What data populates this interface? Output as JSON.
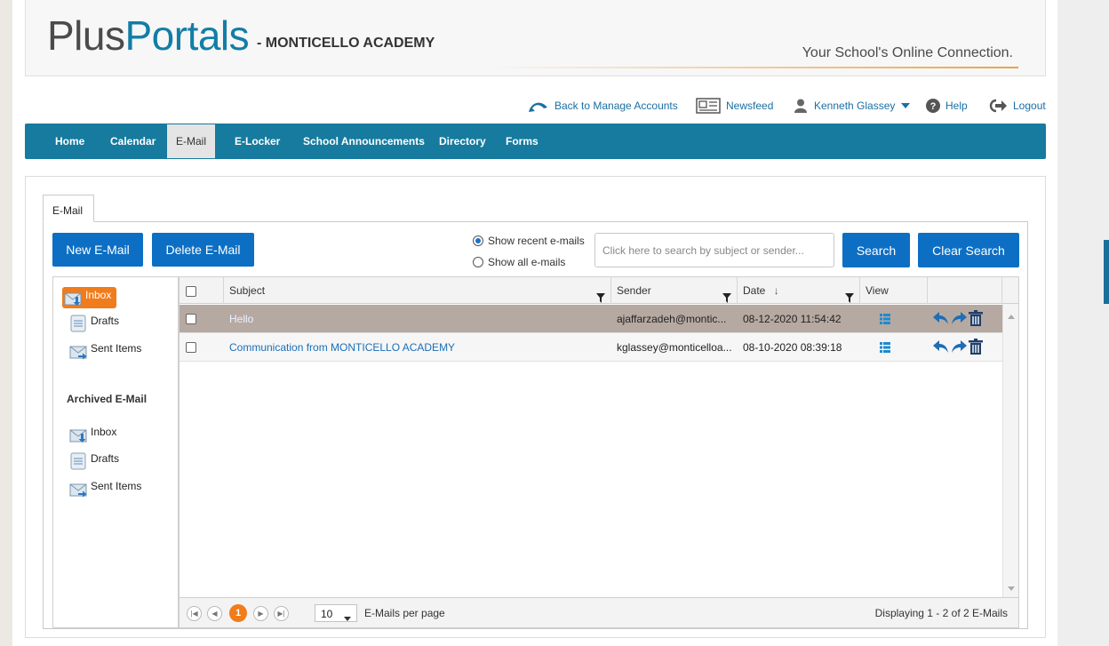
{
  "header": {
    "logo_plus": "Plus",
    "logo_portals": "Portals",
    "school_name": "- MONTICELLO ACADEMY",
    "tagline": "Your School's Online Connection."
  },
  "toplinks": {
    "back": "Back to Manage Accounts",
    "newsfeed": "Newsfeed",
    "user": "Kenneth Glassey",
    "help": "Help",
    "logout": "Logout"
  },
  "nav": [
    "Home",
    "Calendar",
    "E-Mail",
    "E-Locker",
    "School Announcements",
    "Directory",
    "Forms"
  ],
  "nav_active": "E-Mail",
  "email": {
    "tab_label": "E-Mail",
    "new_button": "New E-Mail",
    "delete_button": "Delete E-Mail",
    "radio_recent": "Show recent e-mails",
    "radio_all": "Show all e-mails",
    "radio_selected": "recent",
    "search_placeholder": "Click here to search by subject or sender...",
    "search_button": "Search",
    "clear_button": "Clear Search"
  },
  "folders": {
    "current": [
      {
        "label": "Inbox",
        "icon": "inbox-icon",
        "selected": true
      },
      {
        "label": "Drafts",
        "icon": "drafts-icon"
      },
      {
        "label": "Sent Items",
        "icon": "sent-icon"
      }
    ],
    "archived_title": "Archived E-Mail",
    "archived": [
      {
        "label": "Inbox",
        "icon": "inbox-icon"
      },
      {
        "label": "Drafts",
        "icon": "drafts-icon"
      },
      {
        "label": "Sent Items",
        "icon": "sent-icon"
      }
    ]
  },
  "grid": {
    "columns": {
      "subject": "Subject",
      "sender": "Sender",
      "date": "Date",
      "view": "View"
    },
    "sort_indicator": "↓",
    "rows": [
      {
        "subject": "Hello",
        "sender": "ajaffarzadeh@montic...",
        "date": "08-12-2020 11:54:42",
        "selected": true
      },
      {
        "subject": "Communication from MONTICELLO ACADEMY",
        "sender": "kglassey@monticelloa...",
        "date": "08-10-2020 08:39:18",
        "selected": false
      }
    ]
  },
  "pager": {
    "current_page": "1",
    "page_size": "10",
    "per_page_label": "E-Mails per page",
    "status": "Displaying 1 - 2 of 2 E-Mails"
  },
  "colors": {
    "nav": "#167b9e",
    "button": "#0d6fc4",
    "accent": "#f07c1b",
    "link": "#1b6fb8"
  }
}
